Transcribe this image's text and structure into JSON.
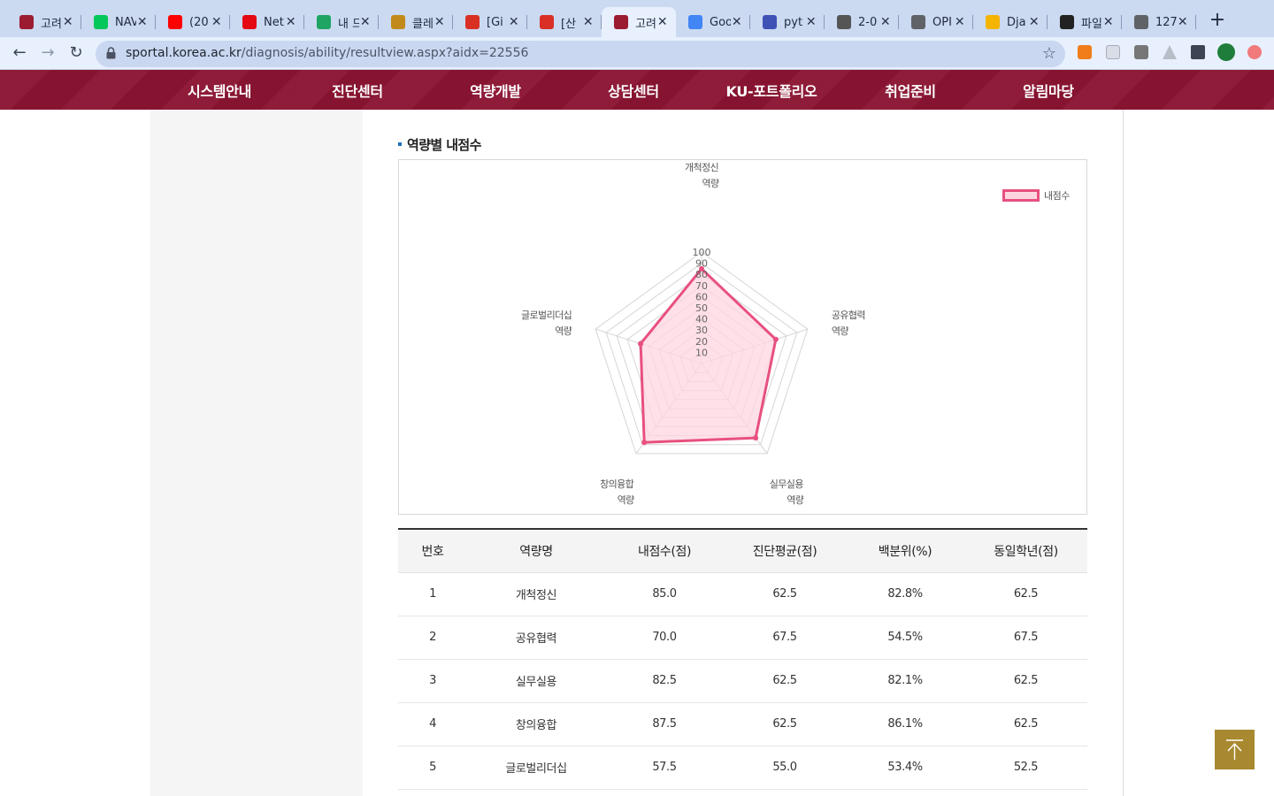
{
  "browser": {
    "tabs": [
      {
        "title": "고려",
        "favicon": "korea-univ",
        "color": "#9b1b30",
        "active": false
      },
      {
        "title": "NAV",
        "favicon": "naver",
        "color": "#03c75a",
        "active": false
      },
      {
        "title": "(20",
        "favicon": "youtube",
        "color": "#ff0000",
        "active": false
      },
      {
        "title": "Net",
        "favicon": "netflix",
        "color": "#e50914",
        "active": false
      },
      {
        "title": "내 드",
        "favicon": "google-drive",
        "color": "#1fa463",
        "active": false
      },
      {
        "title": "클레",
        "favicon": "bird",
        "color": "#c28a1a",
        "active": false
      },
      {
        "title": "[Gi",
        "favicon": "gmail",
        "color": "#d93025",
        "active": false
      },
      {
        "title": "[산",
        "favicon": "gmail",
        "color": "#d93025",
        "active": false
      },
      {
        "title": "고려",
        "favicon": "korea-univ",
        "color": "#9b1b30",
        "active": true
      },
      {
        "title": "Goo",
        "favicon": "google",
        "color": "#4285f4",
        "active": false
      },
      {
        "title": "pyt",
        "favicon": "slack-hash",
        "color": "#3f51b5",
        "active": false
      },
      {
        "title": "2-0",
        "favicon": "wikidocs",
        "color": "#555555",
        "active": false
      },
      {
        "title": "OPI",
        "favicon": "globe",
        "color": "#5f6368",
        "active": false
      },
      {
        "title": "Dja",
        "favicon": "django",
        "color": "#f4b400",
        "active": false
      },
      {
        "title": "파일",
        "favicon": "piano",
        "color": "#222222",
        "active": false
      },
      {
        "title": "127",
        "favicon": "globe",
        "color": "#5f6368",
        "active": false
      }
    ],
    "url_domain": "sportal.korea.ac.kr",
    "url_path": "/diagnosis/ability/resultview.aspx?aidx=22556"
  },
  "site_nav": [
    "시스템안내",
    "진단센터",
    "역량개발",
    "상담센터",
    "KU-포트폴리오",
    "취업준비",
    "알림마당"
  ],
  "section_title": "역량별 내점수",
  "chart_data": {
    "type": "radar",
    "axes": [
      {
        "line1": "개척정신",
        "line2": "역량"
      },
      {
        "line1": "공유협력",
        "line2": "역량"
      },
      {
        "line1": "실무실용",
        "line2": "역량"
      },
      {
        "line1": "창의융합",
        "line2": "역량"
      },
      {
        "line1": "글로벌리더십",
        "line2": "역량"
      }
    ],
    "ticks": [
      10,
      20,
      30,
      40,
      50,
      60,
      70,
      80,
      90,
      100
    ],
    "range": [
      0,
      100
    ],
    "series": [
      {
        "name": "내점수",
        "values": [
          85.0,
          70.0,
          82.5,
          87.5,
          57.5
        ]
      }
    ],
    "colors": {
      "line": "#e8507f",
      "fill": "#ffd6e0",
      "grid": "#d5d5d5"
    }
  },
  "table": {
    "headers": [
      "번호",
      "역량명",
      "내점수(점)",
      "진단평균(점)",
      "백분위(%)",
      "동일학년(점)"
    ],
    "rows": [
      [
        "1",
        "개척정신",
        "85.0",
        "62.5",
        "82.8%",
        "62.5"
      ],
      [
        "2",
        "공유협력",
        "70.0",
        "67.5",
        "54.5%",
        "67.5"
      ],
      [
        "3",
        "실무실용",
        "82.5",
        "62.5",
        "82.1%",
        "62.5"
      ],
      [
        "4",
        "창의융합",
        "87.5",
        "62.5",
        "86.1%",
        "62.5"
      ],
      [
        "5",
        "글로벌리더십",
        "57.5",
        "55.0",
        "53.4%",
        "52.5"
      ]
    ]
  }
}
